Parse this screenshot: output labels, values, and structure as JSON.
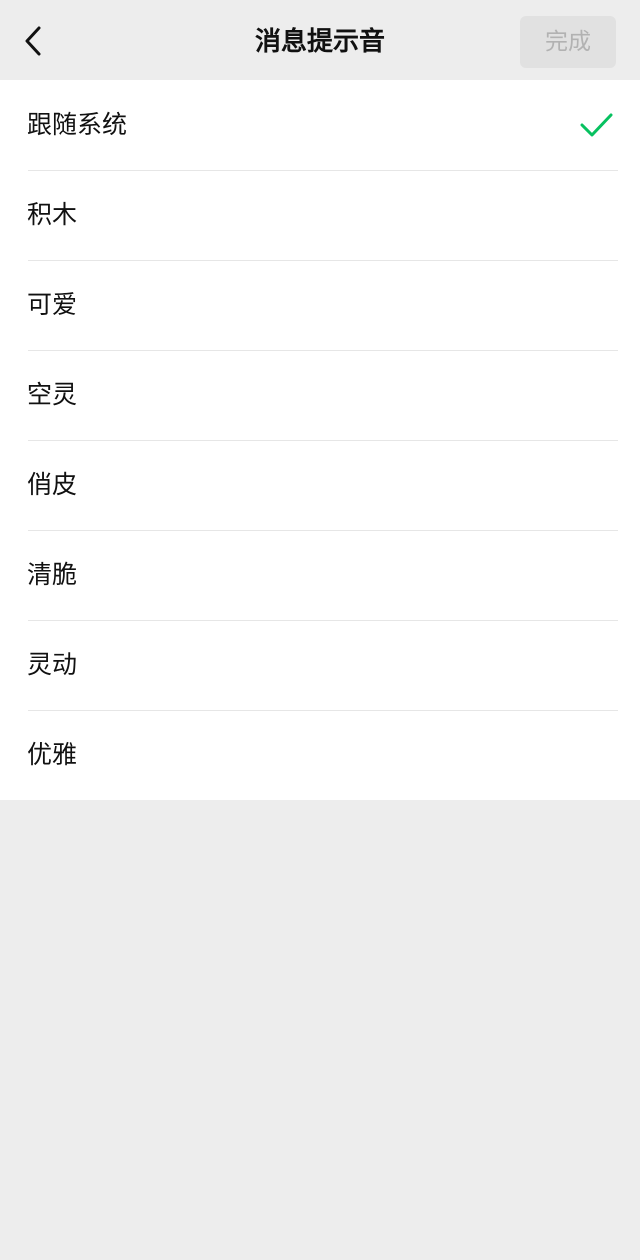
{
  "header": {
    "title": "消息提示音",
    "back_icon": "chevron-left-icon",
    "done_label": "完成"
  },
  "sounds": {
    "selected_index": 0,
    "check_icon": "checkmark-icon",
    "check_color": "#07c160",
    "items": [
      {
        "label": "跟随系统"
      },
      {
        "label": "积木"
      },
      {
        "label": "可爱"
      },
      {
        "label": "空灵"
      },
      {
        "label": "俏皮"
      },
      {
        "label": "清脆"
      },
      {
        "label": "灵动"
      },
      {
        "label": "优雅"
      }
    ]
  }
}
